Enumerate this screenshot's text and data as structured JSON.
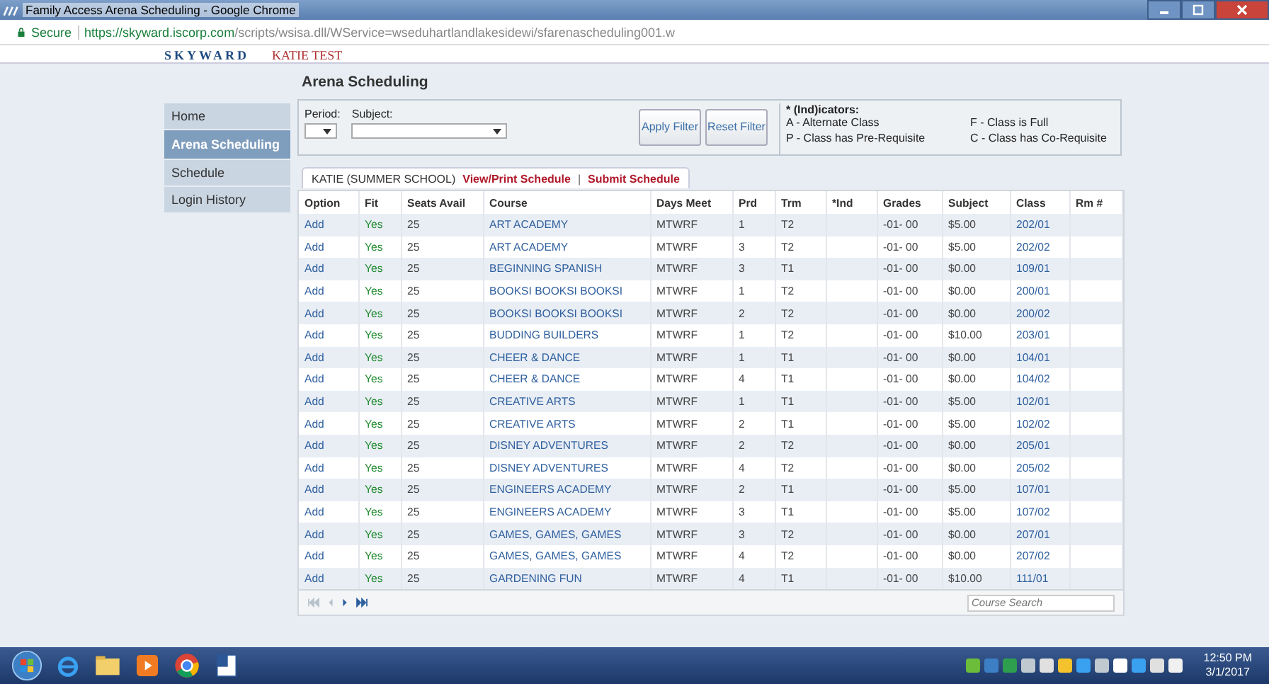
{
  "browser": {
    "title": "Family Access Arena Scheduling - Google Chrome",
    "secure_label": "Secure",
    "url_host": "https://skyward.iscorp.com",
    "url_path": "/scripts/wsisa.dll/WService=wseduhartlandlakesidewi/sfarenascheduling001.w"
  },
  "header": {
    "logo": "SKYWARD",
    "user": "KATIE TEST"
  },
  "sidebar": {
    "items": [
      {
        "label": "Home",
        "selected": false
      },
      {
        "label": "Arena Scheduling",
        "selected": true
      },
      {
        "label": "Schedule",
        "selected": false
      },
      {
        "label": "Login History",
        "selected": false
      }
    ]
  },
  "page_title": "Arena Scheduling",
  "filter": {
    "period_label": "Period:",
    "subject_label": "Subject:",
    "apply_button": "Apply Filter",
    "reset_button": "Reset Filter",
    "indicators_title": "* (Ind)icators:",
    "indicators": [
      "A - Alternate Class",
      "F - Class is Full",
      "P - Class has Pre-Requisite",
      "C - Class has Co-Requisite"
    ]
  },
  "schedule_tab": {
    "student": "KATIE (SUMMER SCHOOL)",
    "links": [
      "View/Print Schedule",
      "Submit Schedule"
    ],
    "separator": "|"
  },
  "table": {
    "columns": [
      "Option",
      "Fit",
      "Seats Avail",
      "Course",
      "Days Meet",
      "Prd",
      "Trm",
      "*Ind",
      "Grades",
      "Subject",
      "Class",
      "Rm #"
    ],
    "rows": [
      {
        "option": "Add",
        "fit": "Yes",
        "seats": "25",
        "course": "ART ACADEMY",
        "days": "MTWRF",
        "prd": "1",
        "trm": "T2",
        "grades": "-01- 00",
        "subject": "$5.00",
        "class": "202/01"
      },
      {
        "option": "Add",
        "fit": "Yes",
        "seats": "25",
        "course": "ART ACADEMY",
        "days": "MTWRF",
        "prd": "3",
        "trm": "T2",
        "grades": "-01- 00",
        "subject": "$5.00",
        "class": "202/02"
      },
      {
        "option": "Add",
        "fit": "Yes",
        "seats": "25",
        "course": "BEGINNING SPANISH",
        "days": "MTWRF",
        "prd": "3",
        "trm": "T1",
        "grades": "-01- 00",
        "subject": "$0.00",
        "class": "109/01"
      },
      {
        "option": "Add",
        "fit": "Yes",
        "seats": "25",
        "course": "BOOKSI BOOKSI BOOKSI",
        "days": "MTWRF",
        "prd": "1",
        "trm": "T2",
        "grades": "-01- 00",
        "subject": "$0.00",
        "class": "200/01"
      },
      {
        "option": "Add",
        "fit": "Yes",
        "seats": "25",
        "course": "BOOKSI BOOKSI BOOKSI",
        "days": "MTWRF",
        "prd": "2",
        "trm": "T2",
        "grades": "-01- 00",
        "subject": "$0.00",
        "class": "200/02"
      },
      {
        "option": "Add",
        "fit": "Yes",
        "seats": "25",
        "course": "BUDDING BUILDERS",
        "days": "MTWRF",
        "prd": "1",
        "trm": "T2",
        "grades": "-01- 00",
        "subject": "$10.00",
        "class": "203/01"
      },
      {
        "option": "Add",
        "fit": "Yes",
        "seats": "25",
        "course": "CHEER & DANCE",
        "days": "MTWRF",
        "prd": "1",
        "trm": "T1",
        "grades": "-01- 00",
        "subject": "$0.00",
        "class": "104/01"
      },
      {
        "option": "Add",
        "fit": "Yes",
        "seats": "25",
        "course": "CHEER & DANCE",
        "days": "MTWRF",
        "prd": "4",
        "trm": "T1",
        "grades": "-01- 00",
        "subject": "$0.00",
        "class": "104/02"
      },
      {
        "option": "Add",
        "fit": "Yes",
        "seats": "25",
        "course": "CREATIVE ARTS",
        "days": "MTWRF",
        "prd": "1",
        "trm": "T1",
        "grades": "-01- 00",
        "subject": "$5.00",
        "class": "102/01"
      },
      {
        "option": "Add",
        "fit": "Yes",
        "seats": "25",
        "course": "CREATIVE ARTS",
        "days": "MTWRF",
        "prd": "2",
        "trm": "T1",
        "grades": "-01- 00",
        "subject": "$5.00",
        "class": "102/02"
      },
      {
        "option": "Add",
        "fit": "Yes",
        "seats": "25",
        "course": "DISNEY ADVENTURES",
        "days": "MTWRF",
        "prd": "2",
        "trm": "T2",
        "grades": "-01- 00",
        "subject": "$0.00",
        "class": "205/01"
      },
      {
        "option": "Add",
        "fit": "Yes",
        "seats": "25",
        "course": "DISNEY ADVENTURES",
        "days": "MTWRF",
        "prd": "4",
        "trm": "T2",
        "grades": "-01- 00",
        "subject": "$0.00",
        "class": "205/02"
      },
      {
        "option": "Add",
        "fit": "Yes",
        "seats": "25",
        "course": "ENGINEERS ACADEMY",
        "days": "MTWRF",
        "prd": "2",
        "trm": "T1",
        "grades": "-01- 00",
        "subject": "$5.00",
        "class": "107/01"
      },
      {
        "option": "Add",
        "fit": "Yes",
        "seats": "25",
        "course": "ENGINEERS ACADEMY",
        "days": "MTWRF",
        "prd": "3",
        "trm": "T1",
        "grades": "-01- 00",
        "subject": "$5.00",
        "class": "107/02"
      },
      {
        "option": "Add",
        "fit": "Yes",
        "seats": "25",
        "course": "GAMES, GAMES, GAMES",
        "days": "MTWRF",
        "prd": "3",
        "trm": "T2",
        "grades": "-01- 00",
        "subject": "$0.00",
        "class": "207/01"
      },
      {
        "option": "Add",
        "fit": "Yes",
        "seats": "25",
        "course": "GAMES, GAMES, GAMES",
        "days": "MTWRF",
        "prd": "4",
        "trm": "T2",
        "grades": "-01- 00",
        "subject": "$0.00",
        "class": "207/02"
      },
      {
        "option": "Add",
        "fit": "Yes",
        "seats": "25",
        "course": "GARDENING FUN",
        "days": "MTWRF",
        "prd": "4",
        "trm": "T1",
        "grades": "-01- 00",
        "subject": "$10.00",
        "class": "111/01"
      }
    ]
  },
  "search": {
    "placeholder": "Course Search"
  },
  "taskbar": {
    "time": "12:50 PM",
    "date": "3/1/2017"
  }
}
